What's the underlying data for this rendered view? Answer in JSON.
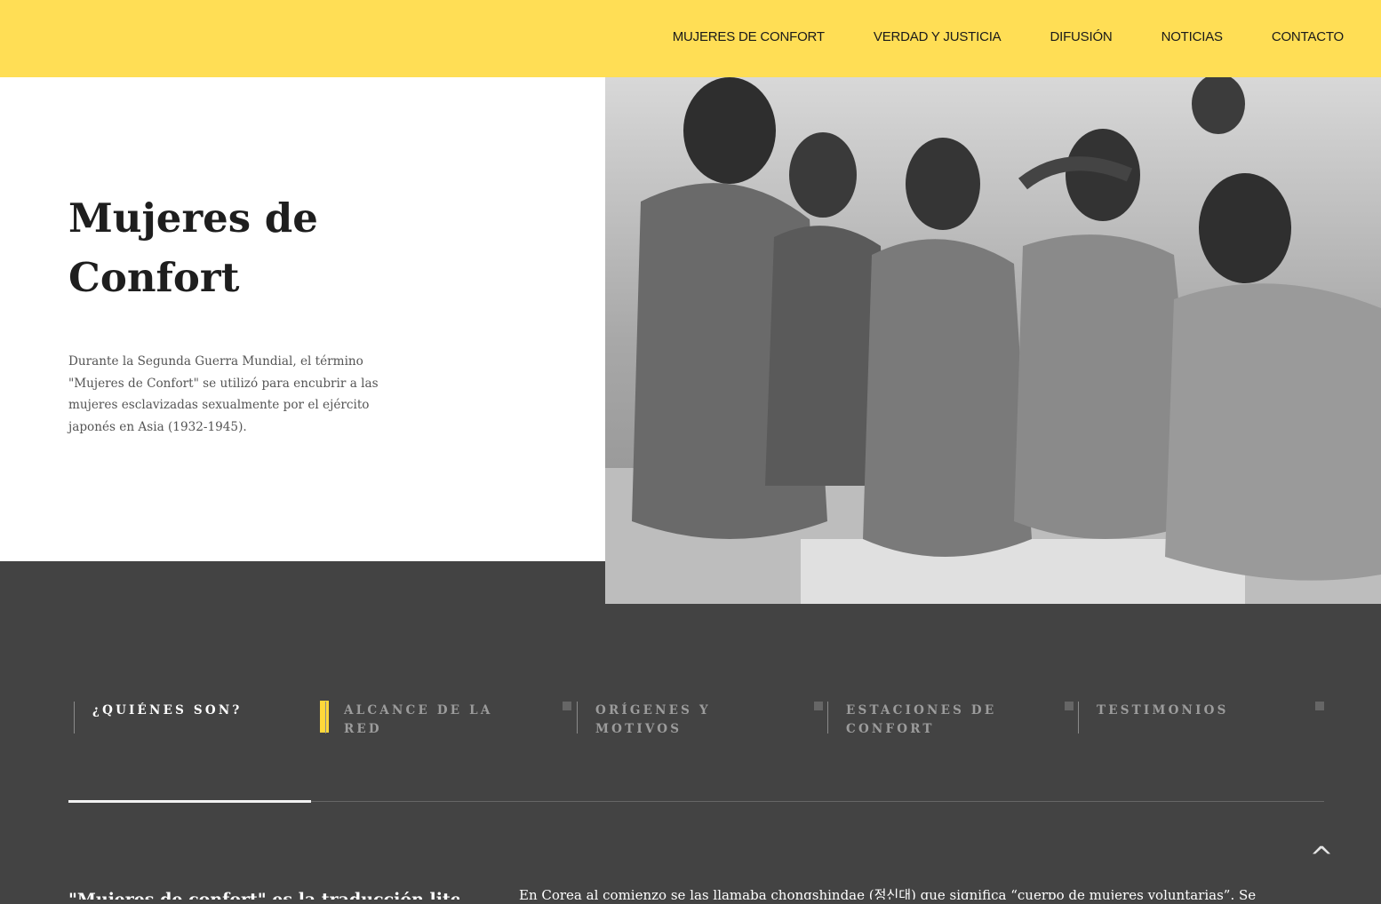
{
  "nav": {
    "items": [
      {
        "label": "MUJERES DE CONFORT"
      },
      {
        "label": "VERDAD Y JUSTICIA"
      },
      {
        "label": "DIFUSIÓN"
      },
      {
        "label": "NOTICIAS"
      },
      {
        "label": "CONTACTO"
      }
    ]
  },
  "hero": {
    "title_line1": "Mujeres de",
    "title_line2": "Confort",
    "description": "Durante la Segunda Guerra Mundial, el término \"Mujeres de Confort\" se utilizó para encubrir a las mujeres esclavizadas sexualmente por el ejército japonés en Asia (1932-1945)."
  },
  "tabs": [
    {
      "label": "¿Quiénes son?"
    },
    {
      "label": "Alcance de la red"
    },
    {
      "label": "Orígenes y motivos"
    },
    {
      "label": "Estaciones de confort"
    },
    {
      "label": "Testimonios"
    }
  ],
  "content": {
    "left_heading": "\"Mujeres de confort\" es la traducción literal",
    "right_text": "En Corea al comienzo se las llamaba chongshindae (정신대) que significa “cuerpo de mujeres voluntarias”. Se las"
  },
  "scroll_top": {
    "icon": "chevron-up-icon",
    "label": "^"
  },
  "colors": {
    "header_bg": "#ffde55",
    "accent": "#ffd83a",
    "dark_bg": "#434343",
    "hero_bg": "#ffffff"
  }
}
